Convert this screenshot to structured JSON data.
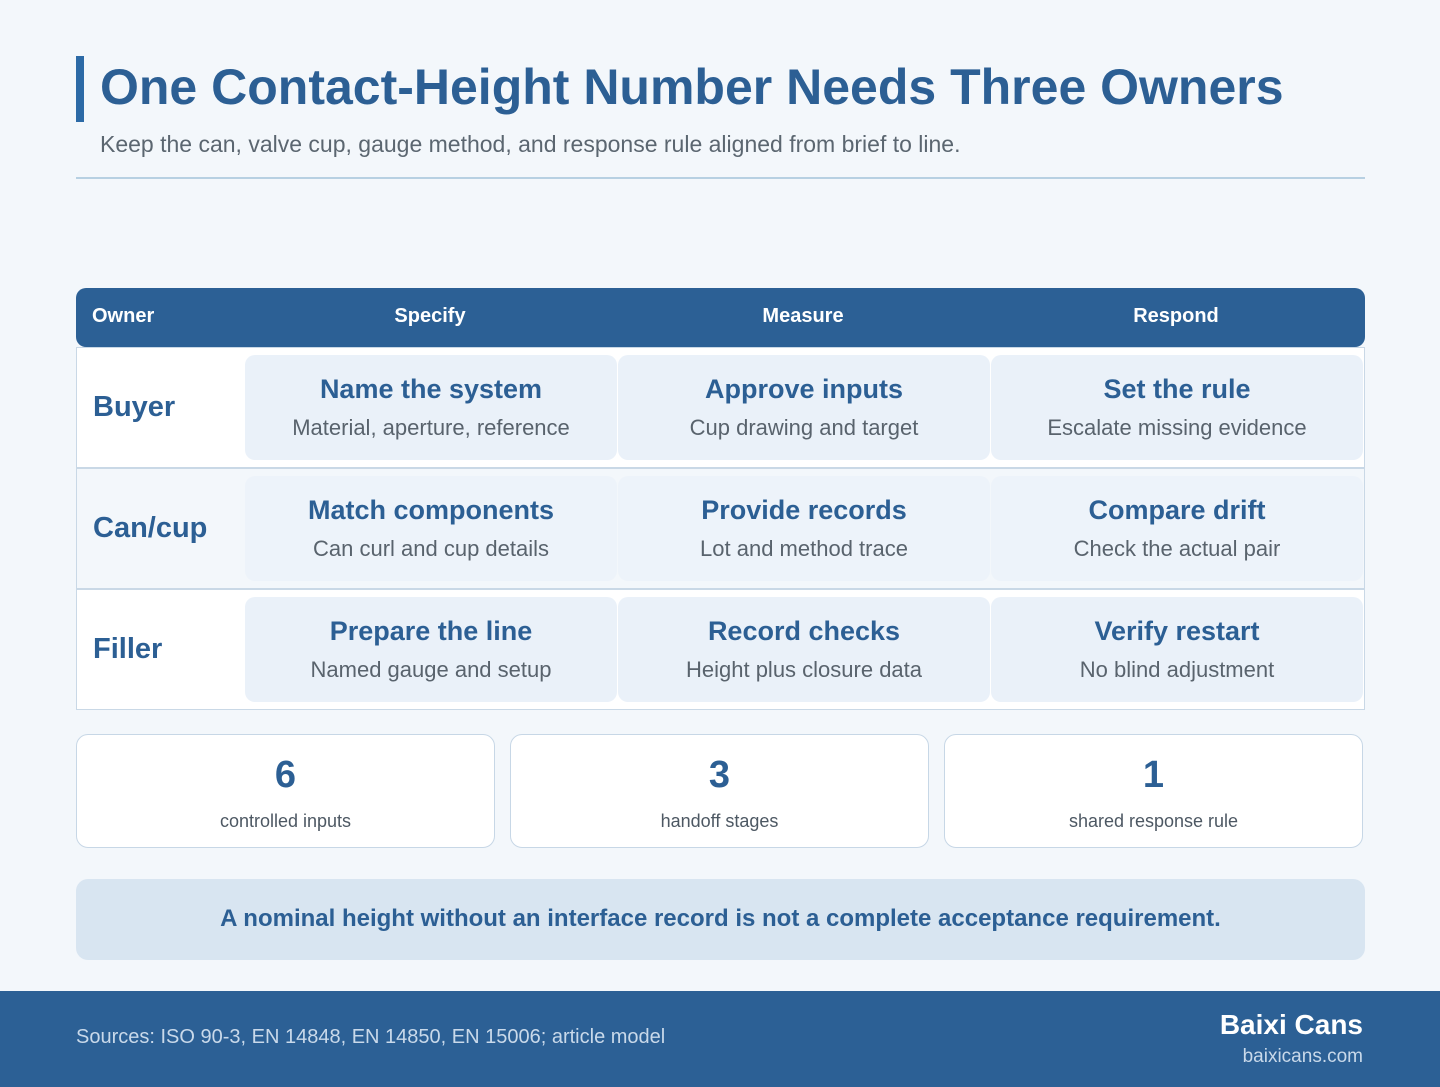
{
  "header": {
    "title": "One Contact-Height Number Needs Three Owners",
    "subtitle": "Keep the can, valve cup, gauge method, and response rule aligned from brief to line."
  },
  "table": {
    "columns": [
      "Owner",
      "Specify",
      "Measure",
      "Respond"
    ],
    "rows": [
      {
        "owner": "Buyer",
        "cells": [
          {
            "title": "Name the system",
            "desc": "Material, aperture, reference"
          },
          {
            "title": "Approve inputs",
            "desc": "Cup drawing and target"
          },
          {
            "title": "Set the rule",
            "desc": "Escalate missing evidence"
          }
        ]
      },
      {
        "owner": "Can/cup",
        "cells": [
          {
            "title": "Match components",
            "desc": "Can curl and cup details"
          },
          {
            "title": "Provide records",
            "desc": "Lot and method trace"
          },
          {
            "title": "Compare drift",
            "desc": "Check the actual pair"
          }
        ]
      },
      {
        "owner": "Filler",
        "cells": [
          {
            "title": "Prepare the line",
            "desc": "Named gauge and setup"
          },
          {
            "title": "Record checks",
            "desc": "Height plus closure data"
          },
          {
            "title": "Verify restart",
            "desc": "No blind adjustment"
          }
        ]
      }
    ]
  },
  "stats": [
    {
      "value": "6",
      "label": "controlled inputs"
    },
    {
      "value": "3",
      "label": "handoff stages"
    },
    {
      "value": "1",
      "label": "shared response rule"
    }
  ],
  "callout": "A nominal height without an interface record is not a complete acceptance requirement.",
  "footer": {
    "sources": "Sources: ISO 90-3, EN 14848, EN 14850, EN 15006; article model",
    "brand": "Baixi Cans",
    "site": "baixicans.com"
  },
  "colors": {
    "accent": "#2c6aa6",
    "header_fill": "#2c6095",
    "title_text": "#2c5f94",
    "cell_fill": "#eaf1f9",
    "callout_fill": "#d8e5f1"
  }
}
